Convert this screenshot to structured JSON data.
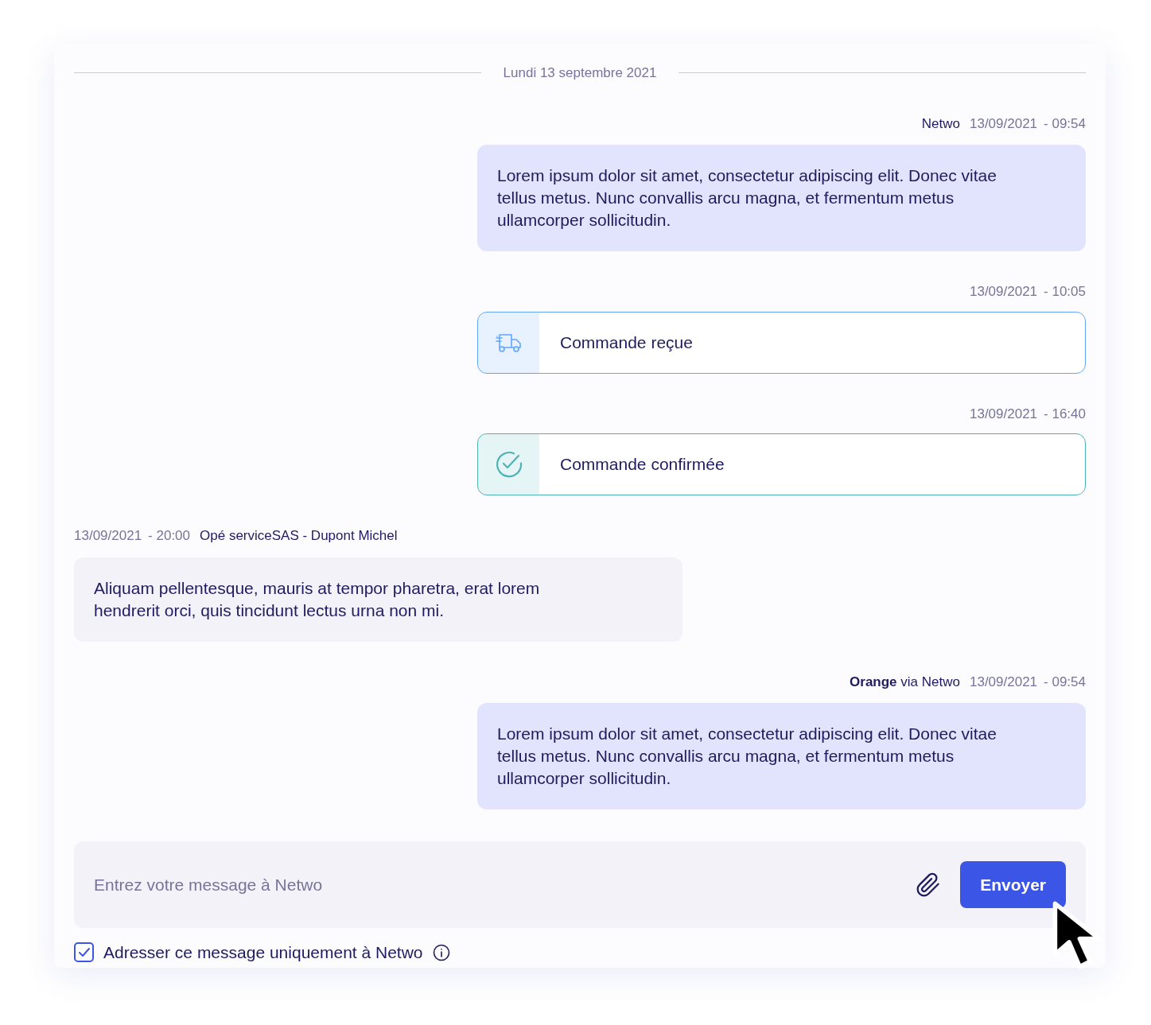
{
  "date_divider": "Lundi 13 septembre 2021",
  "messages": [
    {
      "kind": "outgoing",
      "author": "Netwo",
      "date": "13/09/2021",
      "time": "- 09:54",
      "text": "Lorem ipsum dolor sit amet, consectetur adipiscing elit. Donec vitae tellus metus. Nunc convallis arcu magna, et fermentum metus ullamcorper sollicitudin."
    },
    {
      "kind": "shipped",
      "color": "#60a5fa",
      "date": "13/09/2021",
      "time": "- 10:05",
      "text": "Commande reçue"
    },
    {
      "kind": "confirmed",
      "color": "#4fb3b3",
      "date": "13/09/2021",
      "time": "- 16:40",
      "text": "Commande confirmée"
    },
    {
      "kind": "incoming",
      "author": "Opé serviceSAS - Dupont Michel",
      "date": "13/09/2021",
      "time": "- 20:00",
      "text": "Aliquam pellentesque, mauris at tempor pharetra, erat lorem hendrerit orci, quis tincidunt lectus urna non mi."
    },
    {
      "kind": "outgoing",
      "author": "**Orange** via Netwo",
      "date": "13/09/2021",
      "time": "- 09:54",
      "text": "Lorem ipsum dolor sit amet, consectetur adipiscing elit. Donec vitae tellus metus. Nunc convallis arcu magna, et fermentum metus ullamcorper sollicitudin."
    }
  ],
  "composer": {
    "placeholder": "Entrez votre message à Netwo",
    "send_button": "Envoyer"
  },
  "only_netwo": {
    "label": "Adresser ce message uniquement à Netwo",
    "checked": true
  }
}
